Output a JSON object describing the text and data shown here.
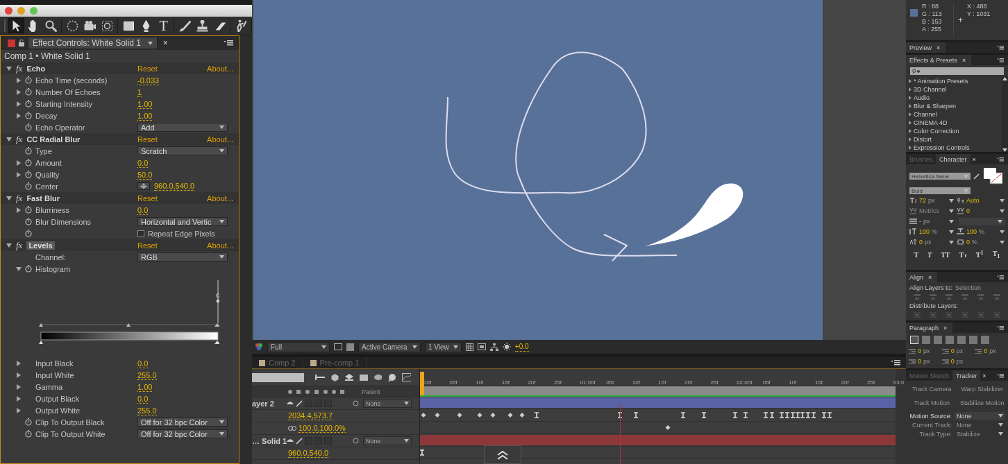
{
  "toolbar": {
    "tool_groups": [
      [
        {
          "kind": "selection",
          "selected": true
        },
        {
          "kind": "hand",
          "selected": false
        },
        {
          "kind": "zoom",
          "selected": false
        }
      ],
      [
        {
          "kind": "rotate",
          "selected": false
        },
        {
          "kind": "camera",
          "selected": false
        },
        {
          "kind": "pan-behind",
          "selected": false
        }
      ],
      [
        {
          "kind": "rectangle",
          "selected": false
        },
        {
          "kind": "pen",
          "selected": false
        },
        {
          "kind": "type",
          "selected": false,
          "glyph": "T"
        }
      ],
      [
        {
          "kind": "brush",
          "selected": false
        },
        {
          "kind": "clone-stamp",
          "selected": false
        },
        {
          "kind": "eraser",
          "selected": false
        }
      ],
      [
        {
          "kind": "puppet",
          "selected": false
        }
      ]
    ]
  },
  "effect_controls": {
    "tab": "Effect Controls: White Solid 1",
    "close": "×",
    "breadcrumb": "Comp 1 • White Solid 1",
    "effects": [
      {
        "badge": "fx",
        "name": "Echo",
        "selected": false,
        "reset": "Reset",
        "about": "About...",
        "properties": [
          {
            "kind": "value",
            "label": "Echo Time (seconds)",
            "expanded": false,
            "stopwatch": true,
            "value": "-0.033"
          },
          {
            "kind": "value",
            "label": "Number Of Echoes",
            "expanded": false,
            "stopwatch": true,
            "value": "1"
          },
          {
            "kind": "value",
            "label": "Starting Intensity",
            "expanded": false,
            "stopwatch": true,
            "value": "1.00"
          },
          {
            "kind": "value",
            "label": "Decay",
            "expanded": false,
            "stopwatch": true,
            "value": "1.00"
          },
          {
            "kind": "dropdown",
            "label": "Echo Operator",
            "stopwatch": true,
            "value": "Add"
          }
        ]
      },
      {
        "badge": "fx",
        "name": "CC Radial Blur",
        "selected": false,
        "reset": "Reset",
        "about": "About...",
        "properties": [
          {
            "kind": "dropdown",
            "label": "Type",
            "stopwatch": true,
            "value": "Scratch"
          },
          {
            "kind": "value",
            "label": "Amount",
            "expanded": false,
            "stopwatch": true,
            "value": "0.0"
          },
          {
            "kind": "value",
            "label": "Quality",
            "expanded": false,
            "stopwatch": true,
            "value": "50.0"
          },
          {
            "kind": "point",
            "label": "Center",
            "stopwatch": true,
            "value": "960.0,540.0"
          }
        ]
      },
      {
        "badge": "fx",
        "name": "Fast Blur",
        "selected": false,
        "reset": "Reset",
        "about": "About...",
        "properties": [
          {
            "kind": "value",
            "label": "Blurriness",
            "expanded": false,
            "stopwatch": true,
            "value": "0.0"
          },
          {
            "kind": "dropdown",
            "label": "Blur Dimensions",
            "stopwatch": true,
            "value": "Horizontal and Vertic"
          },
          {
            "kind": "checkbox",
            "label": "Repeat Edge Pixels",
            "stopwatch": true,
            "checked": false
          }
        ]
      },
      {
        "badge": "fx",
        "name": "Levels",
        "selected": true,
        "reset": "Reset",
        "about": "About...",
        "properties": [
          {
            "kind": "dropdown",
            "label": "Channel:",
            "value": "RGB"
          },
          {
            "kind": "group",
            "label": "Histogram",
            "expanded": true,
            "stopwatch": true
          },
          {
            "kind": "histogram"
          },
          {
            "kind": "value",
            "label": "Input Black",
            "expanded": false,
            "value": "0.0"
          },
          {
            "kind": "value",
            "label": "Input White",
            "expanded": false,
            "value": "255.0"
          },
          {
            "kind": "value",
            "label": "Gamma",
            "expanded": false,
            "value": "1.00"
          },
          {
            "kind": "value",
            "label": "Output Black",
            "expanded": false,
            "value": "0.0"
          },
          {
            "kind": "value",
            "label": "Output White",
            "expanded": false,
            "value": "255.0"
          },
          {
            "kind": "dropdown",
            "label": "Clip To Output Black",
            "stopwatch": true,
            "value": "Off for 32 bpc Color"
          },
          {
            "kind": "dropdown",
            "label": "Clip To Output White",
            "stopwatch": true,
            "value": "Off for 32 bpc Color"
          }
        ]
      }
    ]
  },
  "viewer": {
    "toolbar": {
      "resolution": "Full",
      "camera": "Active Camera",
      "views": "1 View",
      "exposure": "+0.0"
    }
  },
  "timeline": {
    "tabs": [
      {
        "label": "Comp 2",
        "selected": false
      },
      {
        "label": "Pre-comp 1",
        "selected": false
      }
    ],
    "parent_header": "Parent",
    "ruler": [
      "00f",
      "05f",
      "10f",
      "15f",
      "20f",
      "25f",
      "01:00f",
      "05f",
      "10f",
      "15f",
      "20f",
      "25f",
      "02:00f",
      "05f",
      "10f",
      "15f",
      "20f",
      "25f",
      "03:0"
    ],
    "layers": [
      {
        "name": "ayer 2",
        "parent": "None",
        "color": "#5a62a6",
        "properties": [
          {
            "value": "2034.4,573.7",
            "linked": false
          },
          {
            "value": "100.0,100.0%",
            "linked": true
          }
        ]
      },
      {
        "name": "… Solid 1",
        "parent": "None",
        "color": "#8c383b",
        "properties": [
          {
            "value": "960.0,540.0",
            "linked": false
          }
        ]
      }
    ]
  },
  "info": {
    "color": "#587199",
    "channels": [
      "R : 88",
      "G : 113",
      "B : 153",
      "A : 255"
    ],
    "crosshair": "+",
    "coords": [
      "X : 488",
      "Y : 1031"
    ]
  },
  "preview": {
    "tab": "Preview",
    "close": "×"
  },
  "effects_presets": {
    "tab": "Effects & Presets",
    "close": "×",
    "items": [
      "* Animation Presets",
      "3D Channel",
      "Audio",
      "Blur & Sharpen",
      "Channel",
      "CINEMA 4D",
      "Color Correction",
      "Distort",
      "Expression Controls"
    ]
  },
  "character": {
    "tabs": [
      {
        "label": "Brushes",
        "selected": false
      },
      {
        "label": "Character",
        "selected": true
      }
    ],
    "close": "×",
    "font": "Helvetica Neue",
    "style": "Bold",
    "fields": [
      {
        "kind": "size",
        "value": "72",
        "unit": "px",
        "disabled": false
      },
      {
        "kind": "leading",
        "value": "Auto",
        "disabled": false
      },
      {
        "kind": "kerning",
        "value": "Metrics",
        "disabled": true
      },
      {
        "kind": "tracking",
        "value": "0",
        "disabled": false
      },
      {
        "kind": "stroke",
        "value": "-",
        "unit": "px",
        "disabled": false
      },
      {
        "kind": "stroke-style"
      },
      {
        "kind": "vertical-scale",
        "value": "100",
        "unit": "%",
        "disabled": false
      },
      {
        "kind": "horizontal-scale",
        "value": "100",
        "unit": "%",
        "disabled": false
      },
      {
        "kind": "baseline",
        "value": "0",
        "unit": "px",
        "disabled": false
      },
      {
        "kind": "tsume",
        "value": "0",
        "unit": "%",
        "disabled": false
      }
    ],
    "styles": [
      {
        "kind": "bold",
        "label": "T"
      },
      {
        "kind": "italic",
        "label": "T"
      },
      {
        "kind": "caps",
        "label": "TT"
      },
      {
        "kind": "smallcaps",
        "label": "Tt"
      },
      {
        "kind": "super",
        "label": "T$^{1}$"
      },
      {
        "kind": "sub",
        "label": "T$_{1}$"
      }
    ]
  },
  "align": {
    "tab": "Align",
    "close": "×",
    "align_to_label": "Align Layers to:",
    "align_to": "Selection",
    "distribute_label": "Distribute Layers:"
  },
  "paragraph": {
    "tab": "Paragraph",
    "close": "×",
    "alignment": [
      {
        "selected": true
      },
      {
        "selected": false
      },
      {
        "selected": false
      },
      {
        "selected": false
      },
      {
        "selected": false
      },
      {
        "selected": false
      },
      {
        "selected": false
      }
    ],
    "indents": [
      {
        "value": "0",
        "unit": "px"
      },
      {
        "value": "0",
        "unit": "px"
      },
      {
        "value": "0",
        "unit": "px"
      },
      {
        "value": "0",
        "unit": "px"
      },
      {
        "value": "0",
        "unit": "px"
      }
    ]
  },
  "tracker": {
    "tabs": [
      {
        "label": "Motion Sketch",
        "selected": false
      },
      {
        "label": "Tracker",
        "selected": true
      }
    ],
    "close": "×",
    "buttons": [
      {
        "label": "Track Camera",
        "disabled": true
      },
      {
        "label": "Warp Stabilizer",
        "disabled": true
      },
      {
        "label": "Track Motion",
        "disabled": true
      },
      {
        "label": "Stabilize Motion",
        "disabled": true
      }
    ],
    "fields": [
      {
        "label": "Motion Source:",
        "value": "None",
        "disabled": false
      },
      {
        "label": "Current Track:",
        "value": "None",
        "disabled": true
      },
      {
        "label": "Track Type:",
        "value": "Stabilize",
        "disabled": true
      }
    ]
  }
}
